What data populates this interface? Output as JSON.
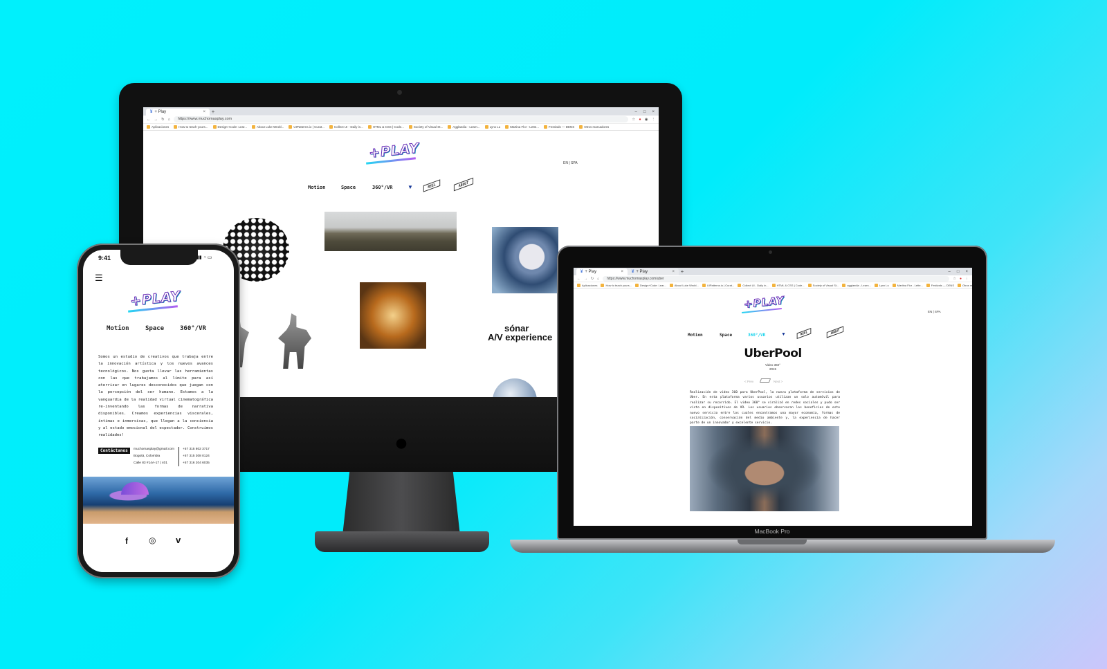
{
  "colors": {
    "background": "#00eefb",
    "logo_stroke": "#6a2fb8",
    "accent_cyan": "#22d7f2"
  },
  "imac": {
    "tabs": [
      {
        "label": "+ Play"
      }
    ],
    "url": "https://www.muchomasplay.com",
    "bookmarks": [
      "Aplicaciones",
      "How to teach yours...",
      "Design+Code: Lear...",
      "About Luke Wrobl...",
      "UIPatterns.io | Curat...",
      "Collect UI - Daily in...",
      "HTML & CSS | Code...",
      "Society of Visual St...",
      "Agglaedia - Learn...",
      "Lynx Lu",
      "Martina Flor - Lette...",
      "Festivals — DENS",
      "Otros marcadores"
    ],
    "logo": "+PLAY",
    "lang": "EN | SPA",
    "nav": [
      "Motion",
      "Space",
      "360°/VR"
    ],
    "tags": [
      "REEL",
      "ABOUT"
    ],
    "sonar_line1": "sónar",
    "sonar_line2": "A/V experience"
  },
  "macbook": {
    "tabs": [
      {
        "label": "+ Play"
      },
      {
        "label": "+ Play"
      }
    ],
    "url": "https://www.muchomasplay.com/uber",
    "bookmarks": [
      "Aplicaciones",
      "How to teach yours...",
      "Design+Code: Lear...",
      "About Luke Wrobl...",
      "UIPatterns.io | Curat...",
      "Collect UI - Daily in...",
      "HTML & CSS | Code...",
      "Society of Visual St...",
      "agglaedia - Learn...",
      "Lynx Lu",
      "Martina Flor - Lette...",
      "Festivals — DENS",
      "Otros marcadores"
    ],
    "logo": "+PLAY",
    "lang": "EN | SPA",
    "nav": [
      "Motion",
      "Space",
      "360°/VR"
    ],
    "tags": [
      "REEL",
      "ABOUT"
    ],
    "project_title": "UberPool",
    "project_type": "Video 360°",
    "project_year": "2015",
    "prev": "< Prev",
    "next": "Next >",
    "description": "Realización de video 360 para UberPool, la nueva plataforma de servicios de Uber. En esta plataforma varios usuarios utilizan un solo automóvil para realizar su recorrido. El video 360° se viralizó en redes sociales y pudo ser visto en dispositivos de VR. Los usuarios observaron los beneficios de este nuevo servicio entre los cuales encontramos una mayor economía, formas de socialización, conservación del medio ambiente y, la experiencia de hacer parte de un innovador y excelente servicio.",
    "brand_label": "MacBook Pro"
  },
  "iphone": {
    "time": "9:41",
    "logo": "+PLAY",
    "nav": [
      "Motion",
      "Space",
      "360°/VR"
    ],
    "about": "Somos un estudio de creativos que trabaja entre la innovación artística y los nuevos avances tecnológicos. Nos gusta llevar las herramientas con las que trabajamos al límite para así aterrizar en lugares desconocidos que juegan con la percepción del ser humano. Estamos a la vanguardia de la realidad virtual cinematográfica re-inventando las formas de narrativa disponibles. Creamos experiencias viscerales, íntimas e inmersivas, que llegan a la conciencia y al estado emocional del espectador. Construimos realidades!",
    "contact_label": "Contáctanos",
    "email": "muchomasplay@gmail.com",
    "city": "Bogotá, Colombia",
    "address": "Calle 83 #14A-17 | 401",
    "phones": [
      "+57 315 802 3717",
      "+57 315 308 0124",
      "+57 316 204 6035"
    ],
    "social": [
      "f",
      "◎",
      "v"
    ]
  }
}
